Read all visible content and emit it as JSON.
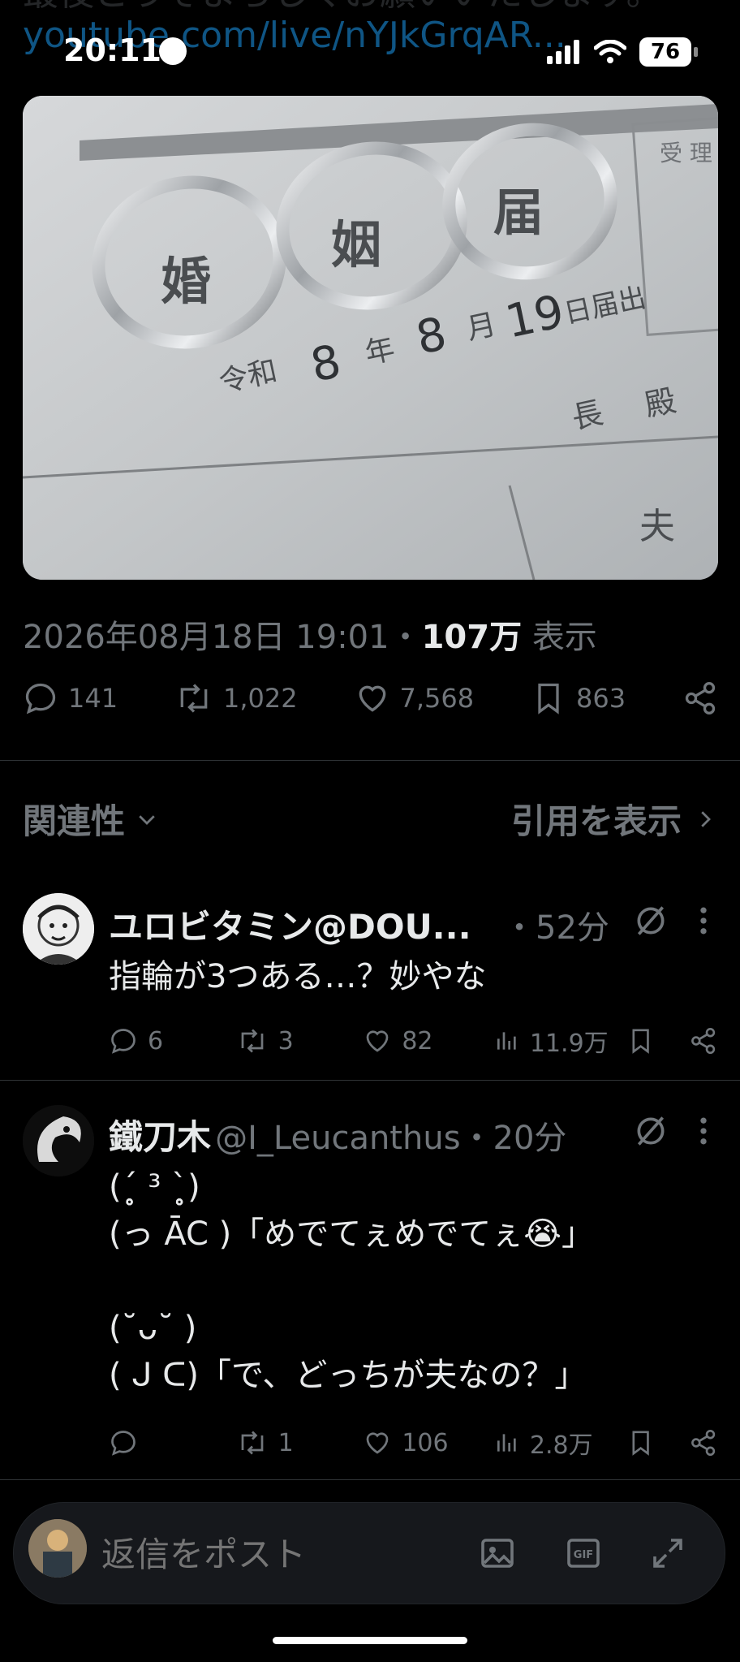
{
  "status": {
    "time": "20:11",
    "battery": "76"
  },
  "underlay": {
    "line1": "最後どうぞよろしくお願いいたします。",
    "line2": "youtube.com/live/nYJkGrqAR..."
  },
  "post": {
    "datetime": "2026年08月18日 19:01",
    "separator": "・",
    "views_count": "107万",
    "views_label": "表示",
    "image": {
      "stamp": "受 理",
      "title_chars": [
        "婚",
        "姻",
        "届"
      ],
      "date_prefix": "令和",
      "date_year": "8",
      "date_nen": "年",
      "date_month": "8",
      "date_gatsu": "月",
      "date_day": "19",
      "date_suffix": "日届出",
      "cho": "長",
      "den": "殿",
      "otto": "夫"
    },
    "stats": {
      "replies": "141",
      "reposts": "1,022",
      "likes": "7,568",
      "bookmarks": "863"
    }
  },
  "sort": {
    "label": "関連性",
    "quotes_label": "引用を表示"
  },
  "replies": [
    {
      "name": "ユロビタミン@DOU...",
      "handle": "",
      "time": "・52分",
      "text": "指輪が3つある…？妙やな",
      "replies": "6",
      "reposts": "3",
      "likes": "82",
      "views": "11.9万"
    },
    {
      "name": "鐵刀木",
      "handle": "@I_Leucanthus",
      "time": "・20分",
      "text": "(ˊ̥̥̥̥̥ ³ ˋ̥̥̥̥̥)\n(っ ĀC )「めでてぇめでてぇ😭」\n\n(˘ᴗ˘ )\n( ᒍ ᑕ)「で、どっちが夫なの？」",
      "replies": "",
      "reposts": "1",
      "likes": "106",
      "views": "2.8万"
    }
  ],
  "composer": {
    "placeholder": "返信をポスト"
  },
  "colors": {
    "background": "#000000",
    "secondary_text": "#71767b",
    "divider": "#2f3336",
    "link": "#1d9bf0"
  }
}
